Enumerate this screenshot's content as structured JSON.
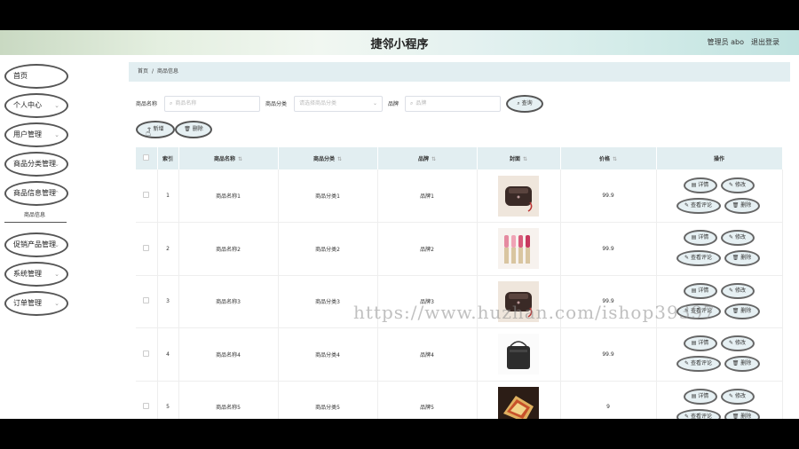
{
  "header": {
    "title": "捷邻小程序",
    "admin": "管理员 abo",
    "logout": "退出登录"
  },
  "sidebar": {
    "items": [
      {
        "label": "首页",
        "arrow": ""
      },
      {
        "label": "个人中心",
        "arrow": "⌄"
      },
      {
        "label": "用户管理",
        "arrow": "⌄"
      },
      {
        "label": "商品分类管理",
        "arrow": "⌄"
      },
      {
        "label": "商品信息管理",
        "arrow": "⌄"
      },
      {
        "label": "促销产品管理",
        "arrow": "⌄"
      },
      {
        "label": "系统管理",
        "arrow": "⌄"
      },
      {
        "label": "订单管理",
        "arrow": "⌄"
      }
    ],
    "submenu": "商品信息"
  },
  "breadcrumb": {
    "home": "首页",
    "sep": "/",
    "current": "商品信息"
  },
  "search": {
    "name_label": "商品名称",
    "name_placeholder": "商品名称",
    "category_label": "商品分类",
    "category_placeholder": "请选择商品分类",
    "brand_label": "品牌",
    "brand_placeholder": "品牌",
    "query_btn": "查询"
  },
  "actions": {
    "add": "新增",
    "delete": "删除"
  },
  "table": {
    "columns": [
      "索引",
      "商品名称",
      "商品分类",
      "品牌",
      "封面",
      "价格",
      "操作"
    ],
    "sort_glyph": "⇅",
    "rows": [
      {
        "index": "1",
        "name": "商品名称1",
        "category": "商品分类1",
        "brand": "品牌1",
        "cover": "handbag-dark",
        "price": "99.9"
      },
      {
        "index": "2",
        "name": "商品名称2",
        "category": "商品分类2",
        "brand": "品牌2",
        "cover": "lipsticks",
        "price": "99.9"
      },
      {
        "index": "3",
        "name": "商品名称3",
        "category": "商品分类3",
        "brand": "品牌3",
        "cover": "handbag-dark",
        "price": "99.9"
      },
      {
        "index": "4",
        "name": "商品名称4",
        "category": "商品分类4",
        "brand": "品牌4",
        "cover": "shoulder-bag",
        "price": "99.9"
      },
      {
        "index": "5",
        "name": "商品名称5",
        "category": "商品分类5",
        "brand": "品牌5",
        "cover": "sandwich",
        "price": "9"
      }
    ],
    "ops": {
      "detail": "详情",
      "edit": "修改",
      "review": "查看评论",
      "delete": "删除"
    }
  },
  "watermark": "https://www.huzhan.com/ishop39397",
  "colors": {
    "header_bg": "#d9ebe6",
    "table_header_bg": "#e2eef1",
    "button_bg": "#e6f0f3"
  }
}
